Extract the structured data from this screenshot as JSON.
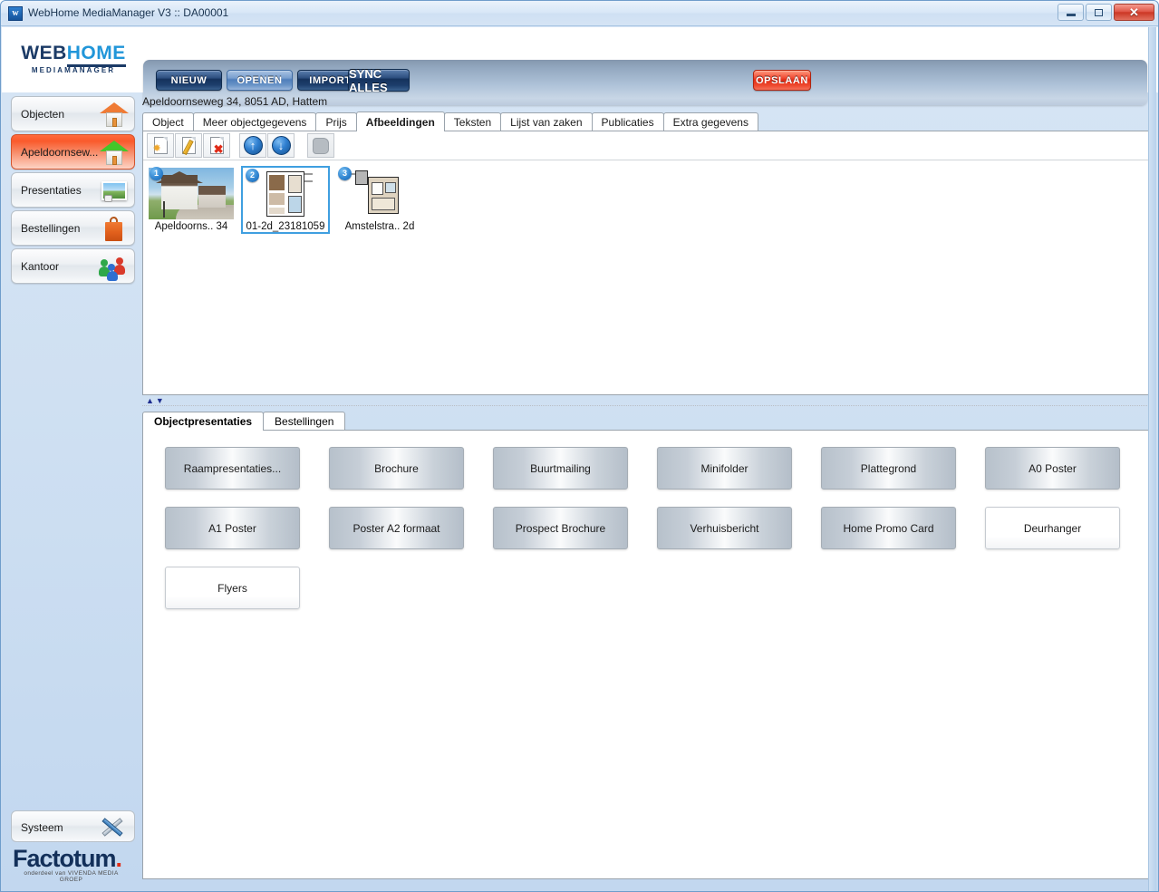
{
  "window": {
    "title": "WebHome MediaManager V3 :: DA00001",
    "app_icon": "w-logo-icon",
    "controls": {
      "minimize": "minimize-icon",
      "maximize": "maximize-icon",
      "close": "✕"
    }
  },
  "brand": {
    "web": "WEB",
    "home": "HOME",
    "sub": "MEDIAMANAGER"
  },
  "toolbar": {
    "buttons": [
      {
        "label": "NIEUW",
        "style": "dark"
      },
      {
        "label": "OPENEN",
        "style": "light"
      },
      {
        "label": "IMPORT",
        "style": "dark"
      },
      {
        "label": "SYNC ALLES",
        "style": "sync"
      }
    ],
    "save_label": "OPSLAAN",
    "accent_save": "#e12d16"
  },
  "sidebar": {
    "items": [
      {
        "label": "Objecten",
        "icon": "house-orange-icon",
        "active": false
      },
      {
        "label": "Apeldoornsew...",
        "icon": "house-green-icon",
        "active": true
      },
      {
        "label": "Presentaties",
        "icon": "photo-camera-icon",
        "active": false
      },
      {
        "label": "Bestellingen",
        "icon": "shopping-bag-icon",
        "active": false
      },
      {
        "label": "Kantoor",
        "icon": "people-group-icon",
        "active": false
      }
    ],
    "system": {
      "label": "Systeem",
      "icon": "wrench-screwdriver-icon"
    },
    "footer_logo": {
      "main": "Factotum",
      "dot": ".",
      "sub": "onderdeel van VIVENDA MEDIA GROEP"
    },
    "active_color": "#fa5a2c"
  },
  "main": {
    "address": "Apeldoornseweg 34, 8051 AD, Hattem",
    "tabs": [
      {
        "label": "Object",
        "active": false
      },
      {
        "label": "Meer objectgegevens",
        "active": false
      },
      {
        "label": "Prijs",
        "active": false
      },
      {
        "label": "Afbeeldingen",
        "active": true
      },
      {
        "label": "Teksten",
        "active": false
      },
      {
        "label": "Lijst van zaken",
        "active": false
      },
      {
        "label": "Publicaties",
        "active": false
      },
      {
        "label": "Extra gegevens",
        "active": false
      }
    ],
    "image_toolbar": [
      {
        "name": "new-image-icon",
        "disabled": false
      },
      {
        "name": "edit-image-icon",
        "disabled": false
      },
      {
        "name": "delete-image-icon",
        "disabled": false
      },
      {
        "name": "move-up-icon",
        "disabled": false
      },
      {
        "name": "move-down-icon",
        "disabled": false
      },
      {
        "name": "watermark-icon",
        "disabled": true
      }
    ],
    "thumbnails": [
      {
        "badge": "1",
        "caption": "Apeldoorns.. 34",
        "kind": "photo",
        "selected": false
      },
      {
        "badge": "2",
        "caption": "01-2d_23181059",
        "kind": "floorplan",
        "selected": true
      },
      {
        "badge": "3",
        "caption": "Amstelstra.. 2d",
        "kind": "floorplan2",
        "selected": false
      }
    ]
  },
  "bottom": {
    "tabs": [
      {
        "label": "Objectpresentaties",
        "active": true
      },
      {
        "label": "Bestellingen",
        "active": false
      }
    ],
    "presentation_buttons": [
      {
        "label": "Raampresentaties...",
        "style": "metal"
      },
      {
        "label": "Brochure",
        "style": "metal"
      },
      {
        "label": "Buurtmailing",
        "style": "metal"
      },
      {
        "label": "Minifolder",
        "style": "metal"
      },
      {
        "label": "Plattegrond",
        "style": "metal"
      },
      {
        "label": "A0 Poster",
        "style": "metal"
      },
      {
        "label": "A1 Poster",
        "style": "metal"
      },
      {
        "label": "Poster A2 formaat",
        "style": "metal"
      },
      {
        "label": "Prospect Brochure",
        "style": "metal"
      },
      {
        "label": "Verhuisbericht",
        "style": "metal"
      },
      {
        "label": "Home Promo Card",
        "style": "metal"
      },
      {
        "label": "Deurhanger",
        "style": "plain"
      },
      {
        "label": "Flyers",
        "style": "plain"
      }
    ]
  }
}
